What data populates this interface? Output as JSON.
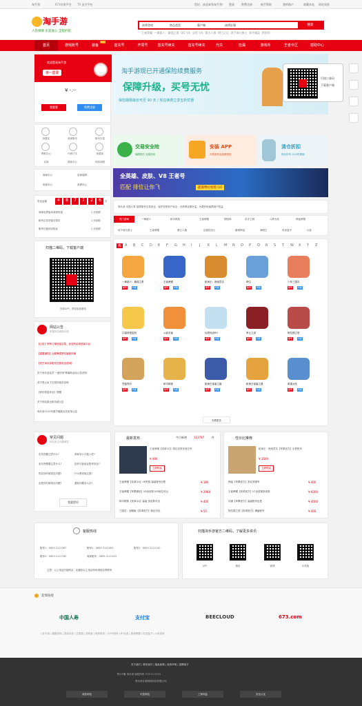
{
  "topbar": {
    "welcome": "淘手游",
    "app": "673交易平台",
    "cooperation": "70 支付平台",
    "right_links": [
      "您好，欢迎来到淘手游！",
      "登录",
      "免费注册",
      "新手帮助",
      "我的账户",
      "买家中心",
      "卖家中心",
      "收藏本站",
      "网站导航"
    ]
  },
  "logo": {
    "name": "淘手游",
    "slogan": "人有保障 买卖放心 全程护航"
  },
  "search": {
    "select1": "选择游戏",
    "select2": "商品类型",
    "select3": "客户端",
    "select4": "选择区服",
    "button": "搜索",
    "hotwords": [
      "王者荣耀",
      "一拳超人：最强之男",
      "QQ飞车",
      "全民飞车",
      "第五人格",
      "明日之后",
      "地下城与勇士",
      "和平精英",
      "阴阳师"
    ]
  },
  "nav": {
    "items": [
      "首页",
      "游戏账号",
      "装备",
      "首充号",
      "开局号",
      "首充号续充",
      "代充",
      "捡漏",
      "游戏币",
      "王者专区",
      "帮助中心"
    ],
    "hot_tag": "HOT"
  },
  "login_card": {
    "greeting": "亲~登录",
    "welcome": "欢迎登录淘手游",
    "balance": "¥ -.--",
    "login_btn": "我要登",
    "register_btn": "免费注册",
    "features": [
      "我要买",
      "卖家账号",
      "账号交易",
      "帮助中心",
      "代练打手",
      "我要卖",
      "买家",
      "退款中心",
      "网站地图"
    ]
  },
  "services": {
    "links": [
      "商家中心",
      "买家保障",
      "卖家中心",
      "资源中心"
    ],
    "safety_label": "安全运营",
    "safety_days": [
      "4",
      "8",
      "7",
      "7",
      "2",
      "6"
    ],
    "safety_unit": "天",
    "records": [
      {
        "text": "商家优质版本商家担保",
        "amount": "1 分钟前"
      },
      {
        "text": "帐号正在担保交易中",
        "amount": "1 分钟前"
      },
      {
        "text": "账号已被成功购买",
        "amount": "1 分钟前"
      }
    ]
  },
  "qr_section": {
    "title": "扫描二维码，下载客户端",
    "caption": "安卓APP，提供免费服务"
  },
  "notice": {
    "title": "网站公告",
    "subtitle": "掌握网站最新动态",
    "items": [
      "【公告】所有订单担保交易，安全购买请选择平台",
      "【重要通知】近期警惕冒充客服诈骗",
      "【关于淘手游账号交易安全说明】",
      "关于淘手游会员'一键代练'等最新活动公告说明",
      "关于禁止私下交易的相关说明",
      "【你的资金安全】提醒",
      "关于网站推出新功能公告",
      "淘手游2019年春节假期业务安排公告"
    ]
  },
  "main_banner": {
    "line1": "淘手游现已开通保险续费服务",
    "line2": "保障升级，买号无忧",
    "line3": "保险期限最长可至 90 天 / 现在续费立享五折优惠"
  },
  "qr_float": {
    "title": "扫描二维码",
    "subtitle": "下载客户端"
  },
  "promos": [
    {
      "title": "交易安全险",
      "sub": "保障双方 交易无忧"
    },
    {
      "title": "安装 APP",
      "sub": "手机发布买卖更轻松"
    },
    {
      "title": "清仓折扣",
      "sub": "低价好号 24小时更新"
    }
  ],
  "game_banner": {
    "title": "全英雄、皮肤、V8 王者号",
    "sub": "匹配 排位让你飞",
    "button": "超值特价抢购 GO"
  },
  "china_life": {
    "text": "淘手游 中国人寿 保障账号交易安全，保护您的财产安全，可获得全额补偿，为更好地保障用户权益"
  },
  "hot_games": {
    "label": "热门游戏",
    "rows": [
      [
        "一拳超人",
        "和平精英",
        "王者荣耀",
        "阴阳师",
        "永冻之城",
        "斗罗大陆",
        "神途荣耀"
      ],
      [
        "地下城与勇士",
        "王者荣耀",
        "第五人格",
        "百度狂战士",
        "魔域神话",
        "海贼王",
        "传世盒子",
        "火影"
      ]
    ]
  },
  "letters": [
    "热",
    "A",
    "B",
    "C",
    "D",
    "E",
    "F",
    "G",
    "H",
    "I",
    "J",
    "K",
    "L",
    "M",
    "N",
    "O",
    "P",
    "Q",
    "R",
    "S",
    "T",
    "W",
    "X",
    "Y",
    "Z"
  ],
  "games": [
    {
      "name": "一拳超人：最强之男",
      "color": "#f4a640",
      "tags": [
        "账号",
        "代练"
      ]
    },
    {
      "name": "王者荣耀",
      "color": "#3866c8",
      "tags": [
        "账号",
        "代练"
      ]
    },
    {
      "name": "航海王：燃烧意志",
      "color": "#d98c2f",
      "tags": [
        "账号",
        "代练"
      ]
    },
    {
      "name": "神泣",
      "color": "#6aa0d8",
      "tags": [
        "账号",
        "代练"
      ]
    },
    {
      "name": "少年三国志",
      "color": "#e87e5b",
      "tags": [
        "账号",
        "代练"
      ]
    },
    {
      "name": "口袋妖怪复刻",
      "color": "#f5c84c",
      "tags": [
        "账号",
        "代练"
      ]
    },
    {
      "name": "火影忍者",
      "color": "#f0903a",
      "tags": [
        "账号",
        "代练"
      ]
    },
    {
      "name": "仙境传说RO",
      "color": "#c3e0f0",
      "tags": [
        "账号",
        "代练"
      ]
    },
    {
      "name": "率土之滨",
      "color": "#8b1f26",
      "tags": [
        "账号",
        "代练"
      ]
    },
    {
      "name": "阿拉德之怒",
      "color": "#b84c48",
      "tags": [
        "账号",
        "代练"
      ]
    },
    {
      "name": "苍蓝誓约",
      "color": "#d3a35b",
      "tags": [
        "账号",
        "代练"
      ]
    },
    {
      "name": "和平精英",
      "color": "#e6b24a",
      "tags": [
        "账号",
        "代练"
      ]
    },
    {
      "name": "航海王强者之路",
      "color": "#3b5ba8",
      "tags": [
        "账号",
        "代练"
      ]
    },
    {
      "name": "航海王强者之路",
      "color": "#e5a33f",
      "tags": [
        "账号",
        "代练"
      ]
    },
    {
      "name": "希望大陆",
      "color": "#5a8fcf",
      "tags": [
        "账号",
        "代练"
      ]
    }
  ],
  "more_btn": "查看更多",
  "faq": {
    "title": "常见问题",
    "sub": "网站常见问题解答",
    "questions": [
      "买东西要注意什么?",
      "商家怎么才能入驻?",
      "卖东西需要注意什么?",
      "如何才能保证账号安全?",
      "购买的时候常见问题?",
      "什么是担保交易?",
      "出售的时候常见问题?",
      "遇到问题怎么办?"
    ],
    "ask_btn": "我要提问"
  },
  "latest": {
    "title": "最新发布",
    "today_label": "今日新增",
    "today_count": "123787",
    "today_unit": "件",
    "featured_title": "王者荣耀【安卓QQ】限定皮肤多段位号",
    "featured_price": "¥ 480",
    "featured_btn": "立即购买",
    "rows": [
      {
        "t": "王者荣耀【安卓QQ】V8贵族 高级账号出售",
        "p": "¥ 180"
      },
      {
        "t": "王者荣耀【苹果微信】V8全皮肤180段位可出",
        "p": "¥ 2988"
      },
      {
        "t": "和平精英【安卓QQ】高级 多皮肤可出",
        "p": "¥ 400"
      },
      {
        "t": "三国志：战略版【安卓官方】新区可出",
        "p": "¥ 55"
      }
    ]
  },
  "cheap": {
    "title": "性价比推荐",
    "featured_title": "航海王：燃烧意志【苹果官方】出售账号",
    "featured_price": "¥ 1500",
    "featured_btn": "立即购买",
    "rows": [
      {
        "t": "神途【苹果官方】多区资源号",
        "p": "¥ 400"
      },
      {
        "t": "王者荣耀【安卓官方】V7全英雄多皮肤",
        "p": "¥ 6000"
      },
      {
        "t": "问道【苹果官方】高级账号出售",
        "p": "¥ 4000"
      },
      {
        "t": "阿拉德之怒【安卓官方】满级账号",
        "p": "¥ 400"
      }
    ]
  },
  "hotline": {
    "title": "客服热线",
    "rows": [
      [
        "账号1：0859-3111567",
        "账号2：0859-3111583",
        "账号3：0859-3111100"
      ],
      [
        "账号4：0859-3111782",
        "商家账号：0859-3112025"
      ]
    ],
    "note": "注意：以上电话只能购买，如遇到以上电话号码请核实再联系"
  },
  "apps": {
    "title": "扫描淘手游官方二维码，了解更多资讯",
    "items": [
      "APP",
      "微信",
      "微博",
      "手机版"
    ]
  },
  "links": {
    "title": "友情链接",
    "partners": [
      "中国人寿",
      "支付宝",
      "BEECLOUD",
      "673.com"
    ],
    "text_links": [
      "八卦手游",
      "捷报游戏",
      "逗游手游",
      "交易猫",
      "游戏宝",
      "电竞资讯",
      "4399游戏",
      "BT手游",
      "游戏联盟",
      "手游盒子",
      "小米游戏"
    ]
  },
  "footer": {
    "links": [
      "关于我们",
      "联系我们",
      "隐私政策",
      "免责声明",
      "招聘英才"
    ],
    "line1": "黔ICP备 淘手游 版权所有 ©2013-2019",
    "line2": "贵州淘手游网络科技有限公司",
    "badges": [
      "诚信网站",
      "可信网站",
      "工商网监",
      "安全认证"
    ]
  },
  "side": {
    "items": [
      "APP",
      "微信",
      "客服",
      "反馈"
    ]
  }
}
